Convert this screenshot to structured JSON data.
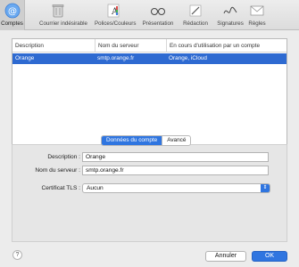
{
  "toolbar": {
    "items": [
      {
        "label": "Comptes",
        "icon": "at-sign-icon"
      },
      {
        "label": "Courrier indésirable",
        "icon": "trash-icon"
      },
      {
        "label": "Polices/Couleurs",
        "icon": "fonts-colors-icon"
      },
      {
        "label": "Présentation",
        "icon": "glasses-icon"
      },
      {
        "label": "Rédaction",
        "icon": "pen-icon"
      },
      {
        "label": "Signatures",
        "icon": "signature-icon"
      },
      {
        "label": "Règles",
        "icon": "rules-mail-icon"
      }
    ]
  },
  "accounts_table": {
    "columns": [
      "Description",
      "Nom du serveur",
      "En cours d'utilisation par un compte"
    ],
    "rows": [
      {
        "description": "Orange",
        "server": "smtp.orange.fr",
        "in_use": "Orange, iCloud"
      }
    ]
  },
  "list_controls": {
    "add": "+",
    "remove": "−"
  },
  "tabs": {
    "account_data": "Données du compte",
    "advanced": "Avancé"
  },
  "form": {
    "description_label": "Description :",
    "description_value": "Orange",
    "server_label": "Nom du serveur :",
    "server_value": "smtp.orange.fr",
    "tls_label": "Certificat TLS :",
    "tls_value": "Aucun"
  },
  "footer": {
    "help": "?",
    "cancel": "Annuler",
    "ok": "OK"
  },
  "colors": {
    "accent": "#2f75e0",
    "selection": "#2e6ad1"
  }
}
